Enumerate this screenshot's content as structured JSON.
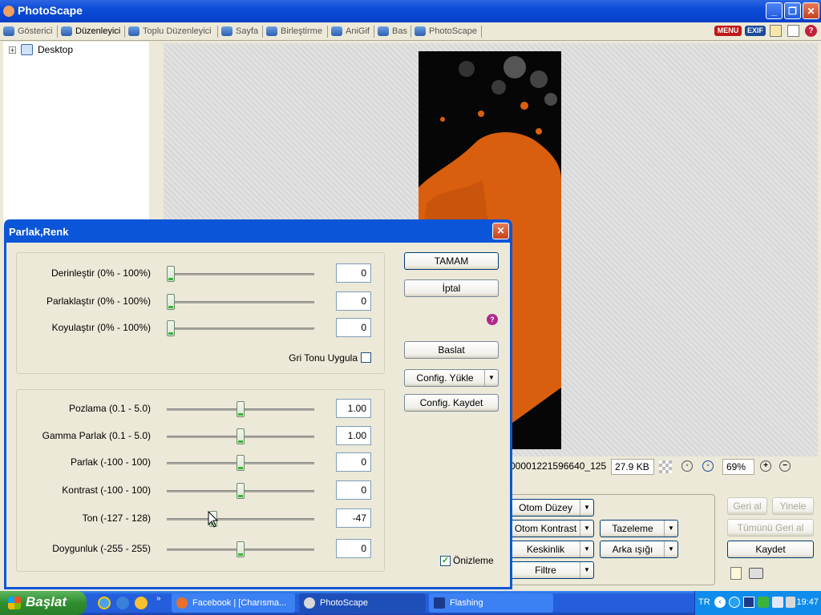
{
  "app": {
    "title": "PhotoScape"
  },
  "tabs": [
    {
      "label": "Gösterici"
    },
    {
      "label": "Düzenleyici"
    },
    {
      "label": "Toplu Düzenleyici"
    },
    {
      "label": "Sayfa"
    },
    {
      "label": "Birleştirme"
    },
    {
      "label": "AniGif"
    },
    {
      "label": "Bas"
    },
    {
      "label": "PhotoScape"
    }
  ],
  "badges": {
    "menu": "MENU",
    "exif": "EXIF"
  },
  "tree": {
    "root": "Desktop"
  },
  "status": {
    "filename": "00001221596640_125",
    "filesize": "27.9 KB",
    "zoom": "69%"
  },
  "panel": {
    "undo": "Geri al",
    "redo": "Yinele",
    "undo_all": "Tümünü Geri al",
    "save": "Kaydet",
    "auto_level": "Otom Düzey",
    "auto_contrast": "Otom Kontrast",
    "refresh": "Tazeleme",
    "sharpness": "Keskinlik",
    "backlight": "Arka ışığı",
    "filter": "Filtre"
  },
  "dialog": {
    "title": "Parlak,Renk",
    "group1": [
      {
        "label": "Derinleştir (0% - 100%)",
        "value": "0",
        "fraction": 0
      },
      {
        "label": "Parlaklaştır (0% - 100%)",
        "value": "0",
        "fraction": 0
      },
      {
        "label": "Koyulaştır (0% - 100%)",
        "value": "0",
        "fraction": 0
      }
    ],
    "grayscale": "Gri Tonu Uygula",
    "group2": [
      {
        "label": "Pozlama (0.1 - 5.0)",
        "value": "1.00",
        "fraction": 0.5
      },
      {
        "label": "Gamma Parlak (0.1 - 5.0)",
        "value": "1.00",
        "fraction": 0.5
      },
      {
        "label": "Parlak (-100 - 100)",
        "value": "0",
        "fraction": 0.5
      },
      {
        "label": "Kontrast (-100 - 100)",
        "value": "0",
        "fraction": 0.5
      },
      {
        "label": "Ton (-127 - 128)",
        "value": "-47",
        "fraction": 0.31
      },
      {
        "label": "Doygunluk (-255 - 255)",
        "value": "0",
        "fraction": 0.5
      }
    ],
    "ok": "TAMAM",
    "cancel": "İptal",
    "start": "Baslat",
    "config_load": "Config. Yükle",
    "config_save": "Config. Kaydet",
    "preview": "Önizleme"
  },
  "taskbar": {
    "start": "Başlat",
    "items": [
      {
        "label": "Facebook | [Charısma..."
      },
      {
        "label": "PhotoScape"
      },
      {
        "label": "Flashing"
      }
    ],
    "lang": "TR",
    "clock": "19:47"
  },
  "colors": {
    "accent": "#0B56D8",
    "splash": "#D95F0E"
  }
}
